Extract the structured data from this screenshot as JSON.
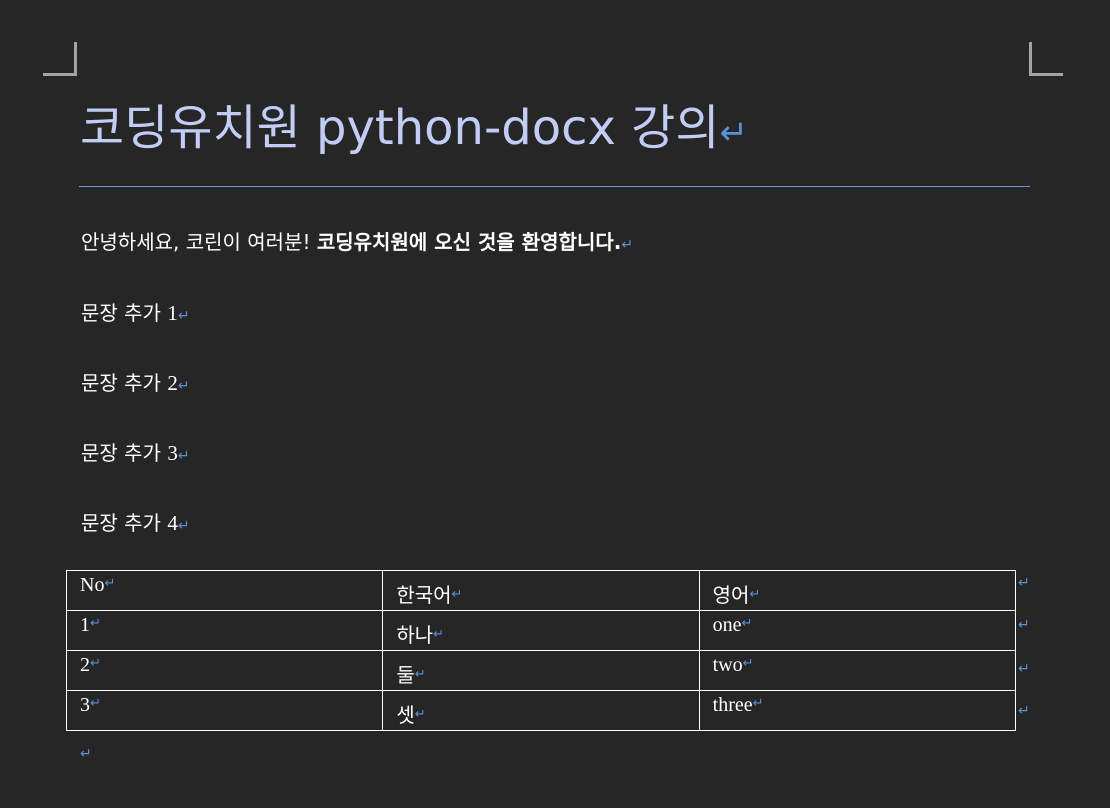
{
  "document": {
    "title": "코딩유치원 python-docx 강의",
    "paragraph_mark": "↵",
    "intro": {
      "normal": "안녕하세요, 코린이 여러분! ",
      "bold": "코딩유치원에 오신 것을 환영합니다."
    },
    "sentences": [
      {
        "text": "문장 추가 ",
        "number": "1"
      },
      {
        "text": "문장 추가 ",
        "number": "2"
      },
      {
        "text": "문장 추가 ",
        "number": "3"
      },
      {
        "text": "문장 추가 ",
        "number": "4"
      }
    ],
    "table": {
      "headers": [
        "No",
        "한국어",
        "영어"
      ],
      "rows": [
        [
          "1",
          "하나",
          "one"
        ],
        [
          "2",
          "둘",
          "two"
        ],
        [
          "3",
          "셋",
          "three"
        ]
      ]
    }
  },
  "colors": {
    "background": "#262626",
    "title": "#c2cdf5",
    "title_rule": "#6f93d9",
    "formatting_mark": "#5b8fd6",
    "body_text": "#ffffff"
  }
}
